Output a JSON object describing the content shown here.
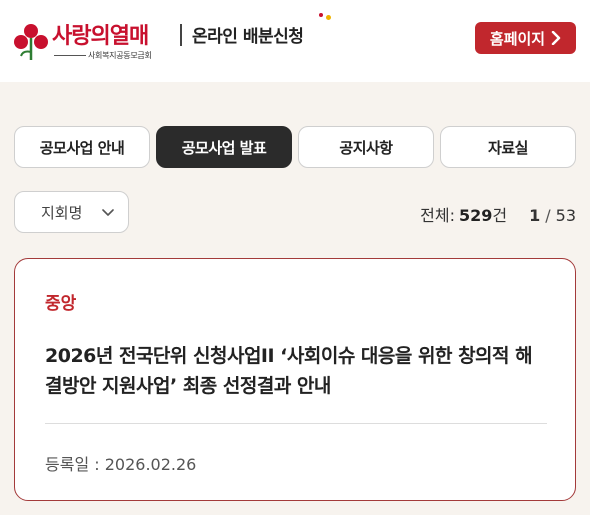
{
  "header": {
    "logo_main": "사랑의열매",
    "logo_sub": "사회복지공동모금회",
    "service_title": "온라인 배분신청",
    "home_button_label": "홈페이지"
  },
  "tabs": [
    {
      "label": "공모사업 안내",
      "active": false
    },
    {
      "label": "공모사업 발표",
      "active": true
    },
    {
      "label": "공지사항",
      "active": false
    },
    {
      "label": "자료실",
      "active": false
    }
  ],
  "filter": {
    "region_selected": "지회명"
  },
  "counts": {
    "total_label": "전체:",
    "total_value": "529",
    "total_unit": "건",
    "page_current": "1",
    "page_total": "53"
  },
  "posts": [
    {
      "region": "중앙",
      "title": "2026년 전국단위 신청사업II ‘사회이슈 대응을 위한 창의적 해결방안 지원사업’ 최종 선정결과 안내",
      "date_label": "등록일 : 2026.02.26"
    }
  ],
  "colors": {
    "brand_red": "#c1272d",
    "active_tab": "#2b2b2b",
    "background": "#f7f3ee"
  }
}
